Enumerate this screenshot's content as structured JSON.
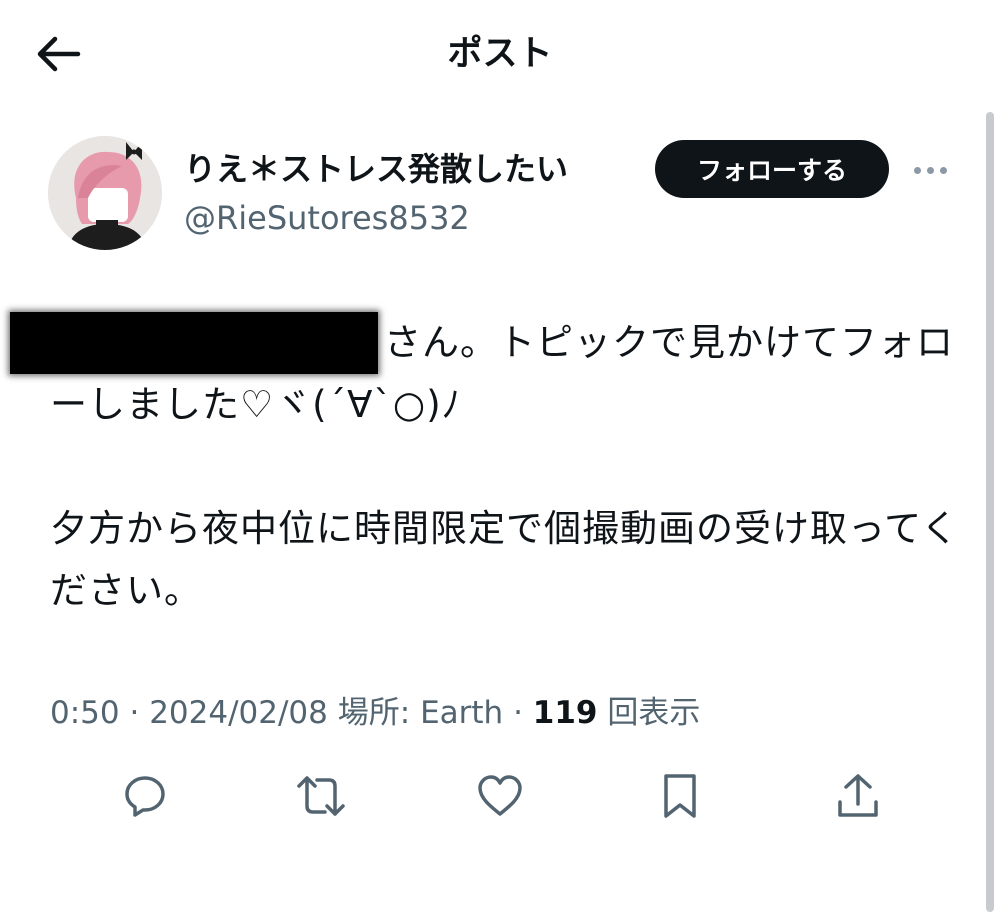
{
  "header": {
    "title": "ポスト",
    "back_icon": "arrow-left-icon"
  },
  "post": {
    "author": {
      "display_name": "りえ＊ストレス発散したい",
      "handle": "@RieSutores8532",
      "avatar": "avatar-image"
    },
    "follow_label": "フォローする",
    "more_icon": "more-horizontal-icon",
    "paragraphs": [
      "さん。トピックで見かけてフォローしました♡ヾ(´∀`○)ﾉ",
      "夕方から夜中位に時間限定で個撮動画の受け取ってください。"
    ],
    "time": "0:50",
    "date": "2024/02/08",
    "location_label": "場所:",
    "location": "Earth",
    "views": "119",
    "views_label": "回表示"
  },
  "actions": [
    {
      "icon": "reply-icon"
    },
    {
      "icon": "repost-icon"
    },
    {
      "icon": "like-icon"
    },
    {
      "icon": "bookmark-icon"
    },
    {
      "icon": "share-icon"
    }
  ],
  "colors": {
    "text": "#0f1419",
    "secondary": "#536471",
    "button_bg": "#0f1419",
    "avatar_hair": "#e89aad"
  }
}
